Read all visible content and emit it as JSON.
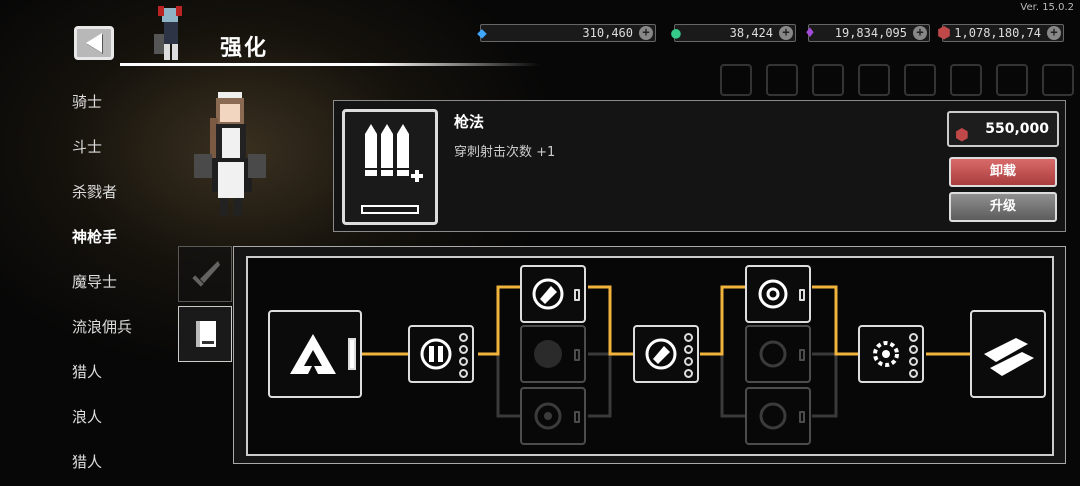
{
  "version": "Ver. 15.0.2",
  "header": {
    "title": "强化"
  },
  "currencies": [
    {
      "icon": "blue-diamond-icon",
      "value": "310,460",
      "color": "#3ea8ff"
    },
    {
      "icon": "green-gem-icon",
      "value": "38,424",
      "color": "#35c98a"
    },
    {
      "icon": "purple-crystal-icon",
      "value": "19,834,095",
      "color": "#a34bd9"
    },
    {
      "icon": "ore-icon",
      "value": "1,078,180,74",
      "color": "#c04848"
    }
  ],
  "sidebar": {
    "items": [
      {
        "label": "骑士"
      },
      {
        "label": "斗士"
      },
      {
        "label": "杀戮者"
      },
      {
        "label": "神枪手"
      },
      {
        "label": "魔导士"
      },
      {
        "label": "流浪佣兵"
      },
      {
        "label": "猎人"
      },
      {
        "label": "浪人"
      },
      {
        "label": "猎人"
      }
    ],
    "active_index": 3
  },
  "skill": {
    "name": "枪法",
    "description": "穿刺射击次数 +1",
    "cost": "550,000",
    "unload_label": "卸载",
    "upgrade_label": "升级"
  },
  "colors": {
    "connector": "#f2b33d",
    "connector_dim": "#3a3a3a"
  }
}
